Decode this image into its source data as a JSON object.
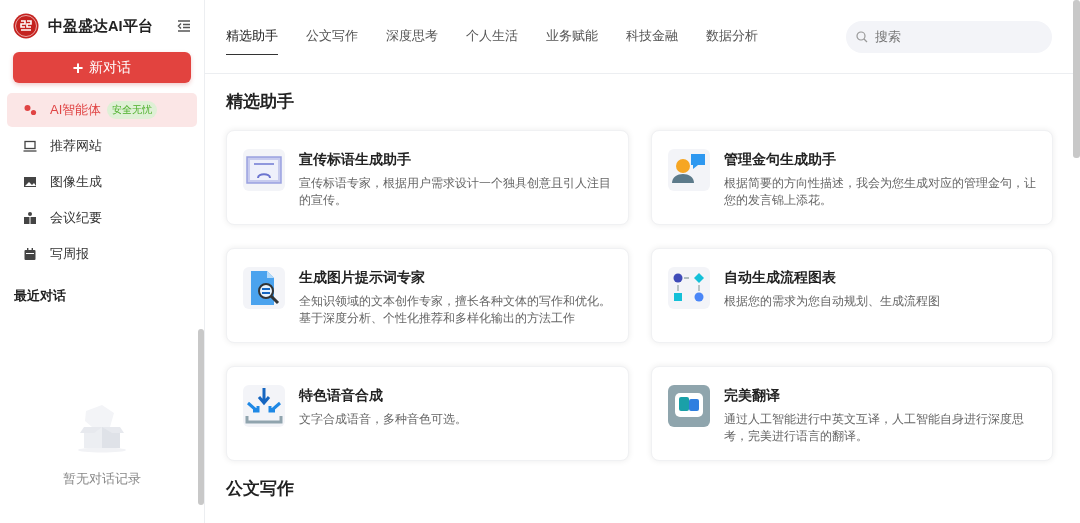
{
  "sidebar": {
    "logo_text": "中盈盛达AI平台",
    "new_chat": {
      "icon": "+",
      "label": "新对话"
    },
    "items": [
      {
        "label": "AI智能体",
        "badge": "安全无忧",
        "selected": true
      },
      {
        "label": "推荐网站",
        "selected": false
      },
      {
        "label": "图像生成",
        "selected": false
      },
      {
        "label": "会议纪要",
        "selected": false
      },
      {
        "label": "写周报",
        "selected": false
      }
    ],
    "recent": {
      "title": "最近对话",
      "empty_text": "暂无对话记录"
    }
  },
  "tabs": [
    {
      "label": "精选助手",
      "selected": true
    },
    {
      "label": "公文写作",
      "selected": false
    },
    {
      "label": "深度思考",
      "selected": false
    },
    {
      "label": "个人生活",
      "selected": false
    },
    {
      "label": "业务赋能",
      "selected": false
    },
    {
      "label": "科技金融",
      "selected": false
    },
    {
      "label": "数据分析",
      "selected": false
    }
  ],
  "search": {
    "placeholder": "搜索"
  },
  "sections": [
    {
      "title": "精选助手",
      "cards": [
        {
          "title": "宣传标语生成助手",
          "desc": "宣传标语专家，根据用户需求设计一个独具创意且引人注目的宣传。"
        },
        {
          "title": "管理金句生成助手",
          "desc": "根据简要的方向性描述，我会为您生成对应的管理金句，让您的发言锦上添花。"
        },
        {
          "title": "生成图片提示词专家",
          "desc": "全知识领域的文本创作专家，擅长各种文体的写作和优化。基于深度分析、个性化推荐和多样化输出的方法工作"
        },
        {
          "title": "自动生成流程图表",
          "desc": "根据您的需求为您自动规划、生成流程图"
        },
        {
          "title": "特色语音合成",
          "desc": "文字合成语音，多种音色可选。"
        },
        {
          "title": "完美翻译",
          "desc": "通过人工智能进行中英文互译，人工智能自身进行深度思考，完美进行语言的翻译。"
        }
      ]
    },
    {
      "title": "公文写作"
    }
  ]
}
